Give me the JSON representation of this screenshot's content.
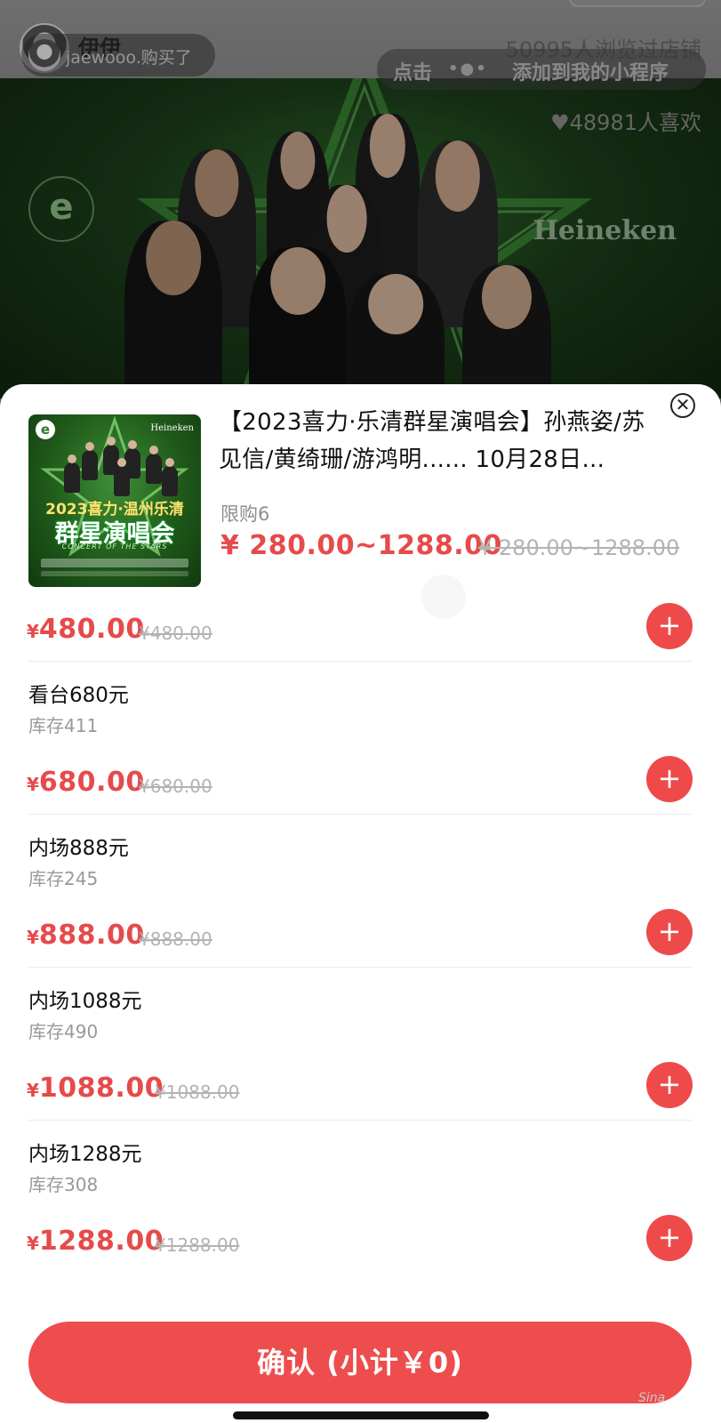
{
  "background": {
    "shop_name": "伊伊",
    "visitors_text": "50995人浏览过店铺",
    "buyer_toast": "jaewooo.购买了",
    "mini_program_banner": {
      "prefix": "点击",
      "dots": "•●•",
      "suffix": "添加到我的小程序"
    },
    "likes_text": "48981人喜欢",
    "poster_logo": "e",
    "poster_brand": "Heineken"
  },
  "sheet": {
    "thumbnail": {
      "logo": "e",
      "brand": "Heineken",
      "title_line1": "2023喜力·温州乐清",
      "title_line2": "群星演唱会",
      "subtitle": "CONCERT OF THE STARS"
    },
    "product_title": "【2023喜力·乐清群星演唱会】孙燕姿/苏见信/黄绮珊/游鸿明...... 10月28日...",
    "close_symbol": "✕",
    "purchase_limit": "限购6",
    "price_range": "¥ 280.00~1288.00",
    "original_price_range": "¥ 280.00~1288.00",
    "currency_symbol": "¥",
    "add_symbol": "+",
    "tiers": [
      {
        "name": "",
        "stock": "",
        "price": "480.00",
        "original": "¥480.00"
      },
      {
        "name": "看台680元",
        "stock": "库存411",
        "price": "680.00",
        "original": "¥680.00"
      },
      {
        "name": "内场888元",
        "stock": "库存245",
        "price": "888.00",
        "original": "¥888.00"
      },
      {
        "name": "内场1088元",
        "stock": "库存490",
        "price": "1088.00",
        "original": "¥1088.00"
      },
      {
        "name": "内场1288元",
        "stock": "库存308",
        "price": "1288.00",
        "original": "¥1288.00"
      }
    ],
    "confirm_label": "确认 (小计￥0)",
    "watermark": "Sina"
  },
  "colors": {
    "accent_red": "#ee4a4a",
    "price_red": "#e64a4a",
    "muted_text": "#999999",
    "poster_green": "#1f5a1a"
  }
}
